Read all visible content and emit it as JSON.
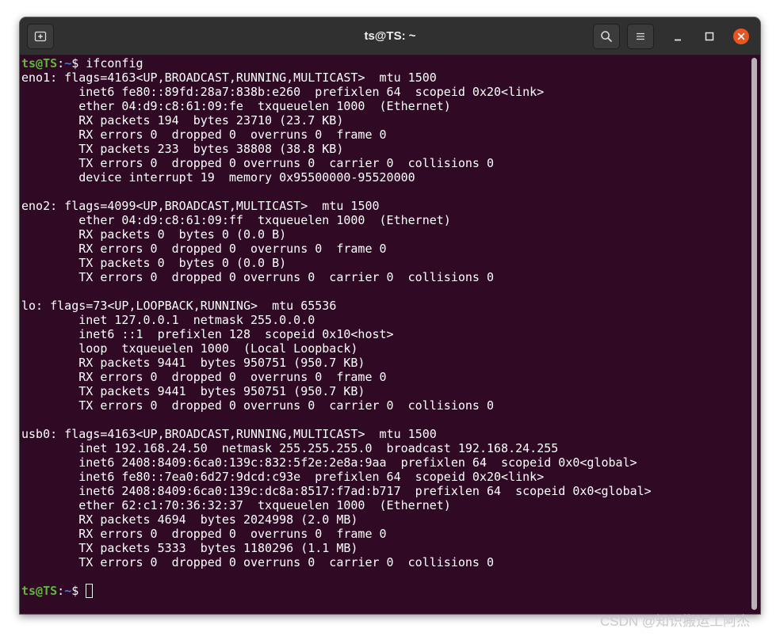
{
  "window": {
    "title": "ts@TS: ~"
  },
  "icons": {
    "new_tab": "new-tab-icon",
    "search": "search-icon",
    "menu": "hamburger-menu-icon",
    "minimize": "minimize-icon",
    "maximize": "maximize-icon",
    "close": "close-icon"
  },
  "colors": {
    "page_background": "#ffffff",
    "titlebar": "#303030",
    "terminal_background": "#300a24",
    "terminal_foreground": "#ffffff",
    "prompt_user_host": "#5fb83a",
    "prompt_path": "#4a78c2",
    "close_button": "#e95420",
    "scrollbar": "#b9b1b7"
  },
  "terminal": {
    "prompt": {
      "user_host": "ts@TS",
      "separator": ":",
      "path": "~",
      "symbol": "$"
    },
    "command": "ifconfig",
    "interfaces": [
      {
        "header": "eno1: flags=4163<UP,BROADCAST,RUNNING,MULTICAST>  mtu 1500",
        "details": [
          "inet6 fe80::89fd:28a7:838b:e260  prefixlen 64  scopeid 0x20<link>",
          "ether 04:d9:c8:61:09:fe  txqueuelen 1000  (Ethernet)",
          "RX packets 194  bytes 23710 (23.7 KB)",
          "RX errors 0  dropped 0  overruns 0  frame 0",
          "TX packets 233  bytes 38808 (38.8 KB)",
          "TX errors 0  dropped 0 overruns 0  carrier 0  collisions 0",
          "device interrupt 19  memory 0x95500000-95520000"
        ]
      },
      {
        "header": "eno2: flags=4099<UP,BROADCAST,MULTICAST>  mtu 1500",
        "details": [
          "ether 04:d9:c8:61:09:ff  txqueuelen 1000  (Ethernet)",
          "RX packets 0  bytes 0 (0.0 B)",
          "RX errors 0  dropped 0  overruns 0  frame 0",
          "TX packets 0  bytes 0 (0.0 B)",
          "TX errors 0  dropped 0 overruns 0  carrier 0  collisions 0"
        ]
      },
      {
        "header": "lo: flags=73<UP,LOOPBACK,RUNNING>  mtu 65536",
        "details": [
          "inet 127.0.0.1  netmask 255.0.0.0",
          "inet6 ::1  prefixlen 128  scopeid 0x10<host>",
          "loop  txqueuelen 1000  (Local Loopback)",
          "RX packets 9441  bytes 950751 (950.7 KB)",
          "RX errors 0  dropped 0  overruns 0  frame 0",
          "TX packets 9441  bytes 950751 (950.7 KB)",
          "TX errors 0  dropped 0 overruns 0  carrier 0  collisions 0"
        ]
      },
      {
        "header": "usb0: flags=4163<UP,BROADCAST,RUNNING,MULTICAST>  mtu 1500",
        "details": [
          "inet 192.168.24.50  netmask 255.255.255.0  broadcast 192.168.24.255",
          "inet6 2408:8409:6ca0:139c:832:5f2e:2e8a:9aa  prefixlen 64  scopeid 0x0<global>",
          "inet6 fe80::7ea0:6d27:9dcd:c93e  prefixlen 64  scopeid 0x20<link>",
          "inet6 2408:8409:6ca0:139c:dc8a:8517:f7ad:b717  prefixlen 64  scopeid 0x0<global>",
          "ether 62:c1:70:36:32:37  txqueuelen 1000  (Ethernet)",
          "RX packets 4694  bytes 2024998 (2.0 MB)",
          "RX errors 0  dropped 0  overruns 0  frame 0",
          "TX packets 5333  bytes 1180296 (1.1 MB)",
          "TX errors 0  dropped 0 overruns 0  carrier 0  collisions 0"
        ]
      }
    ]
  },
  "watermark": "CSDN @知识搬运工阿杰"
}
